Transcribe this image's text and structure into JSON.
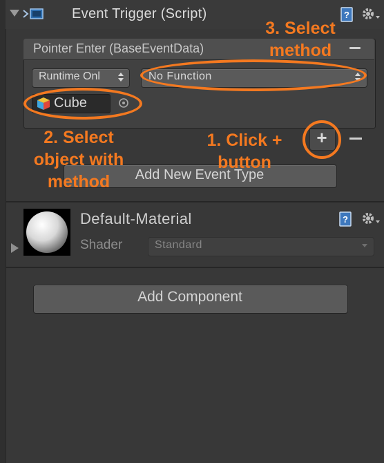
{
  "component": {
    "title": "Event Trigger (Script)",
    "event_entry": {
      "label": "Pointer Enter (BaseEventData)",
      "runtime_value": "Runtime Onl",
      "function_value": "No Function",
      "object_value": "Cube"
    },
    "add_event_label": "Add New Event Type"
  },
  "material": {
    "title": "Default-Material",
    "shader_label": "Shader",
    "shader_value": "Standard"
  },
  "add_component_label": "Add Component",
  "annotations": {
    "step1": "1. Click + button",
    "step2": "2. Select object with method",
    "step3": "3. Select method"
  },
  "colors": {
    "annotation": "#f47920",
    "background": "#383838"
  }
}
